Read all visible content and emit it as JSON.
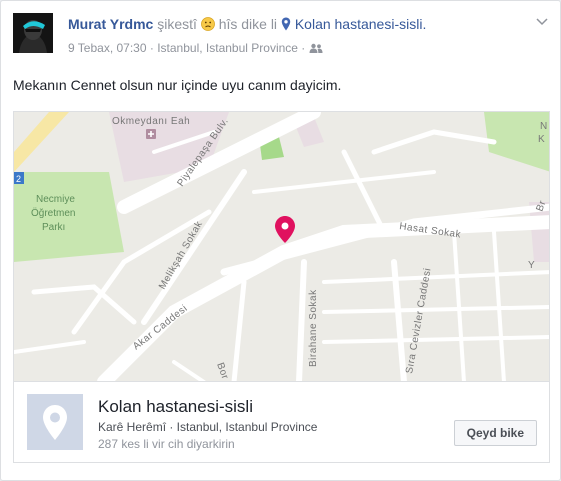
{
  "post": {
    "author": "Murat Yrdmc",
    "feeling_verb": "şikestî",
    "feeling_connector": "hîs dike li",
    "place_name": "Kolan hastanesi-sisli.",
    "timestamp": "9 Tebax, 07:30",
    "location": "Istanbul, Istanbul Province",
    "text": "Mekanın Cennet olsun nur içinde uyu canım dayicim."
  },
  "map": {
    "labels": {
      "hospital": "Okmeydanı Eah",
      "park_line1": "Necmiye",
      "park_line2": "Öğretmen",
      "park_line3": "Parkı",
      "piyalepasa": "Piyalepaşa Bulv.",
      "meliksah": "Melikşah Sokak",
      "hasat": "Hasat Sokak",
      "akar": "Akar Caddesi",
      "birahane": "Birahane Sokak",
      "sira": "Sıra Cevizler Caddesi",
      "bor": "Bor",
      "edge_right1": "Br",
      "edge_right2": "Y",
      "edge_right3": "N",
      "edge_right4": "K",
      "edge_right5": "Ka",
      "edge_left": "2"
    },
    "colors": {
      "pin": "#e0115f",
      "green": "#c8e6b0"
    }
  },
  "place_card": {
    "name": "Kolan hastanesi-sisli",
    "category": "Karê Herêmî · Istanbul, Istanbul Province",
    "visits": "287 kes li vir cih diyarkirin",
    "save_label": "Qeyd bike"
  }
}
